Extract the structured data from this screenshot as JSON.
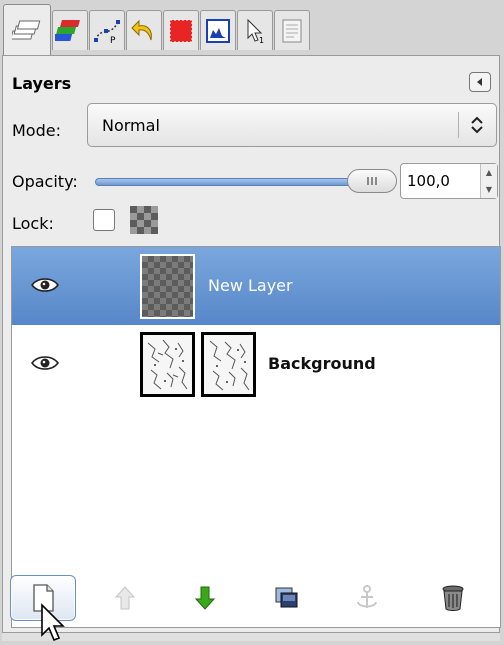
{
  "tabs": [
    {
      "name": "layers-tab-icon",
      "active": true
    },
    {
      "name": "channels-tab-icon"
    },
    {
      "name": "paths-tab-icon"
    },
    {
      "name": "undo-history-tab-icon"
    },
    {
      "name": "colors-tab-icon"
    },
    {
      "name": "histogram-tab-icon"
    },
    {
      "name": "pointer-tab-icon"
    },
    {
      "name": "document-tab-icon"
    }
  ],
  "panel": {
    "title": "Layers",
    "mode_label": "Mode:",
    "mode_value": "Normal",
    "opacity_label": "Opacity:",
    "opacity_value": "100,0",
    "opacity_fraction": 1.0,
    "lock_label": "Lock:",
    "lock_pixels_checked": false
  },
  "layers": [
    {
      "name": "New Layer",
      "visible": true,
      "selected": true,
      "thumbnail": "transparent-checker"
    },
    {
      "name": "Background",
      "visible": true,
      "selected": false,
      "thumbnail": "sketch",
      "has_mask": true
    }
  ],
  "bottom_buttons": [
    "new-layer-button",
    "raise-layer-button",
    "lower-layer-button",
    "duplicate-layer-button",
    "anchor-layer-button",
    "delete-layer-button"
  ],
  "colors": {
    "selection": "#5f8fcf",
    "slider": "#6f99d4",
    "lower_arrow": "#3aa81a"
  }
}
